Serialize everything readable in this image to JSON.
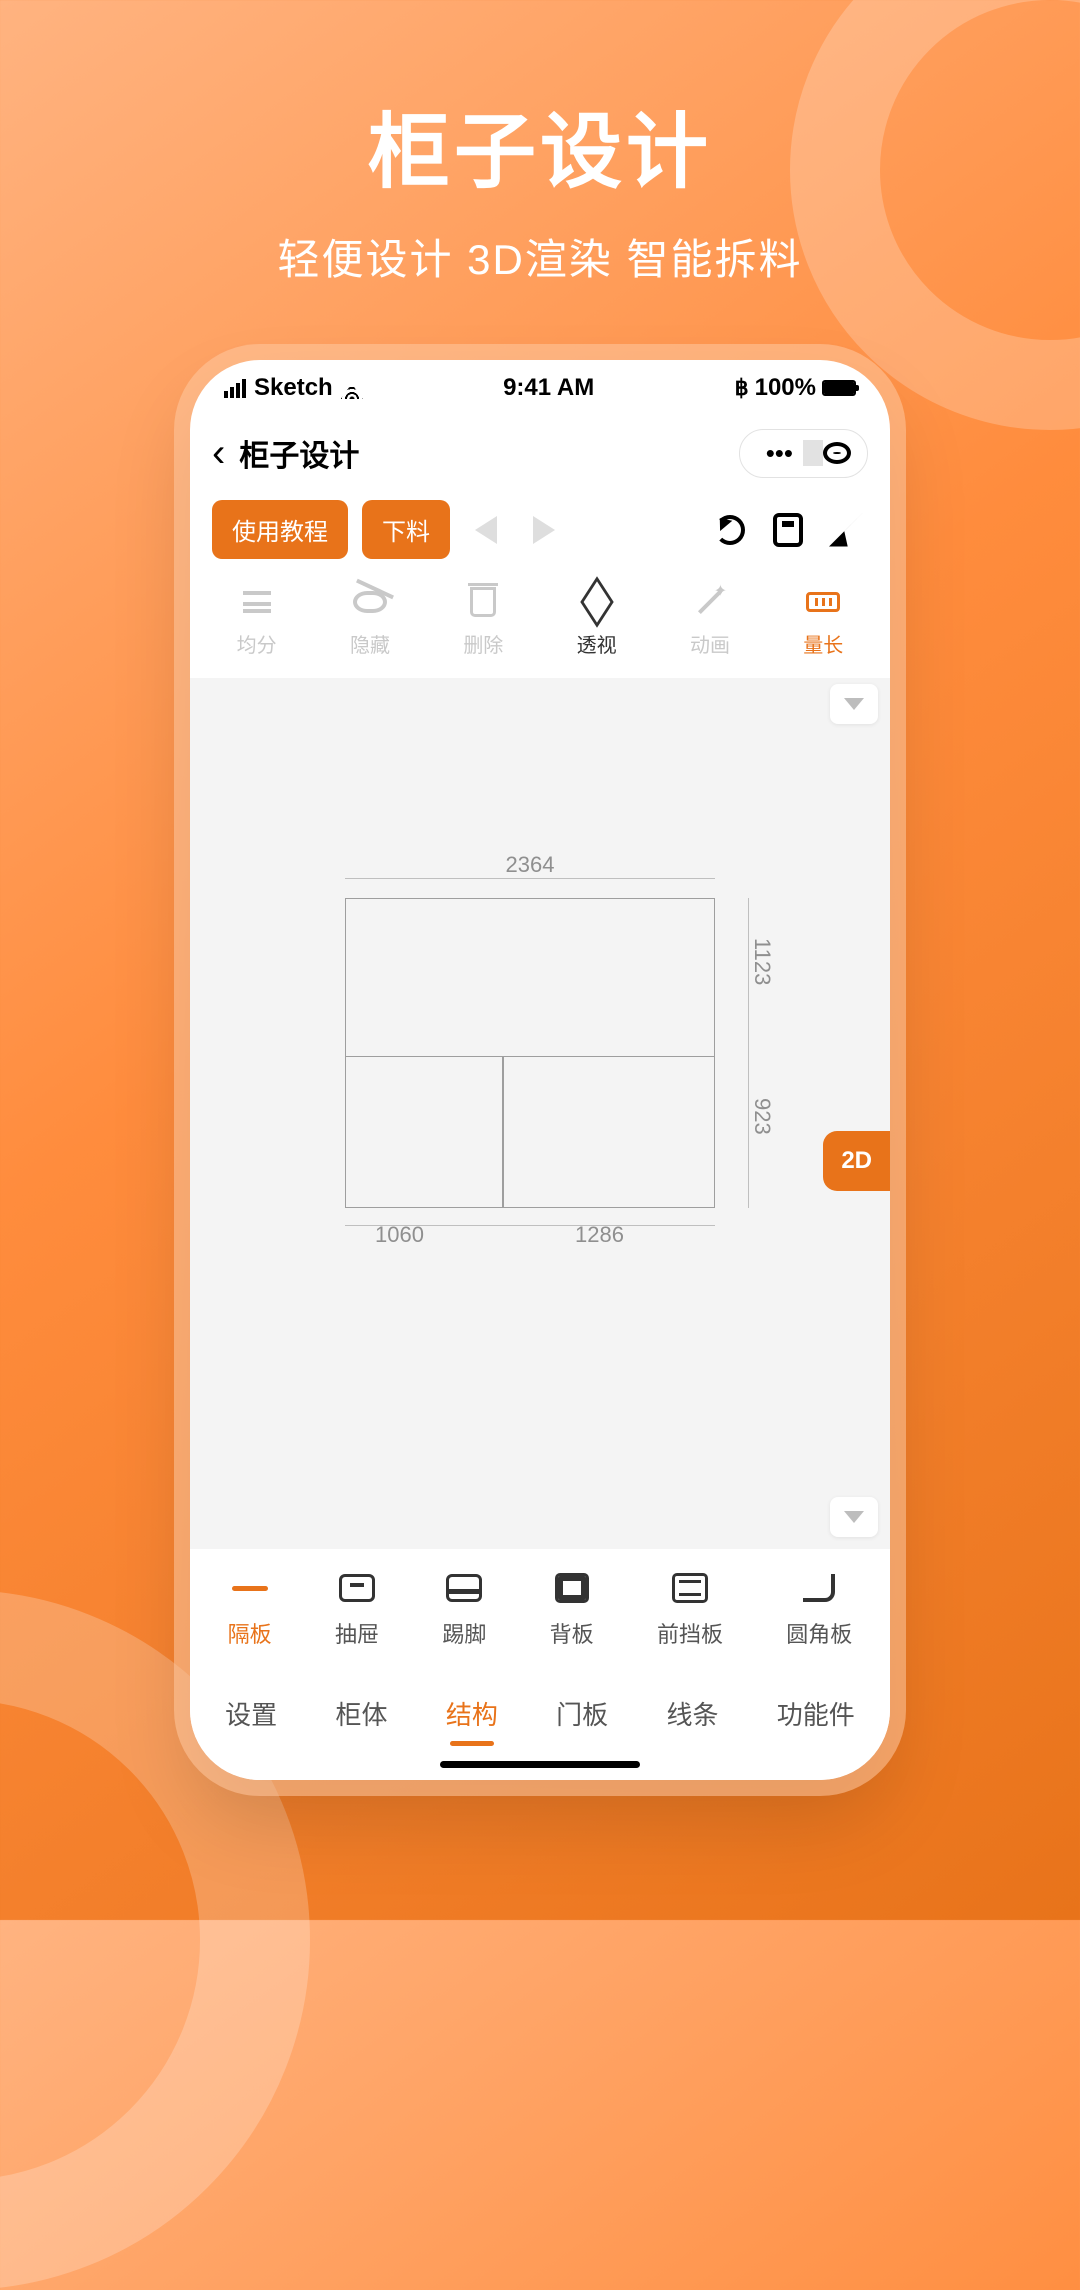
{
  "promo": {
    "title": "柜子设计",
    "subtitle": "轻便设计  3D渲染  智能拆料"
  },
  "statusbar": {
    "carrier": "Sketch",
    "time": "9:41 AM",
    "battery": "100%"
  },
  "nav": {
    "title": "柜子设计"
  },
  "actions": {
    "tutorial": "使用教程",
    "cut": "下料"
  },
  "tools": [
    {
      "id": "divide",
      "label": "均分"
    },
    {
      "id": "hide",
      "label": "隐藏"
    },
    {
      "id": "delete",
      "label": "删除"
    },
    {
      "id": "view3d",
      "label": "透视"
    },
    {
      "id": "animate",
      "label": "动画"
    },
    {
      "id": "measure",
      "label": "量长"
    }
  ],
  "canvas": {
    "top": "2364",
    "right1": "1123",
    "right2": "923",
    "bottom1": "1060",
    "bottom2": "1286",
    "mode": "2D"
  },
  "components": [
    {
      "id": "shelf",
      "label": "隔板"
    },
    {
      "id": "drawer",
      "label": "抽屉"
    },
    {
      "id": "kick",
      "label": "踢脚"
    },
    {
      "id": "back",
      "label": "背板"
    },
    {
      "id": "front",
      "label": "前挡板"
    },
    {
      "id": "corner",
      "label": "圆角板"
    }
  ],
  "tabs": [
    {
      "id": "settings",
      "label": "设置"
    },
    {
      "id": "body",
      "label": "柜体"
    },
    {
      "id": "struct",
      "label": "结构"
    },
    {
      "id": "door",
      "label": "门板"
    },
    {
      "id": "line",
      "label": "线条"
    },
    {
      "id": "func",
      "label": "功能件"
    }
  ]
}
